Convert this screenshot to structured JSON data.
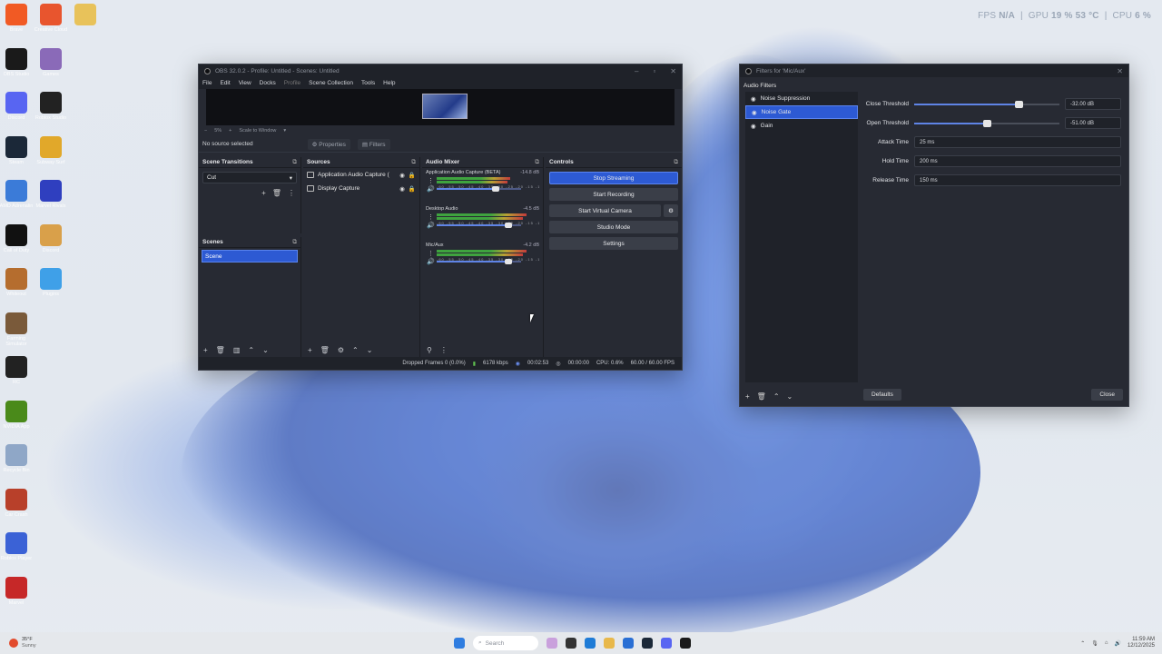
{
  "hud": {
    "fps_label": "FPS",
    "fps_value": "N/A",
    "gpu_label": "GPU",
    "gpu_value": "19 % 53 °C",
    "cpu_label": "CPU",
    "cpu_value": "6 %"
  },
  "desktop_icons": [
    {
      "label": "Brave",
      "color": "#f15a24"
    },
    {
      "label": "OBS Studio",
      "color": "#1a1a1a"
    },
    {
      "label": "Discord",
      "color": "#5865f2"
    },
    {
      "label": "Steam",
      "color": "#1b2838"
    },
    {
      "label": "AMD Adrenalin",
      "color": "#3b7bd8"
    },
    {
      "label": "Call of Duty",
      "color": "#111"
    },
    {
      "label": "Whiteout",
      "color": "#b56d2e"
    },
    {
      "label": "Farming Simulator",
      "color": "#7a5a3a"
    },
    {
      "label": "RC",
      "color": "#222"
    },
    {
      "label": "NVIDIA App",
      "color": "#4a8a1a"
    },
    {
      "label": "Recycle Bin",
      "color": "#8fa7c7"
    },
    {
      "label": "Car Crash",
      "color": "#b8402a"
    },
    {
      "label": "Roblox Player",
      "color": "#3b62d6"
    },
    {
      "label": "Marvel",
      "color": "#c62828"
    }
  ],
  "desktop_icons_col2": [
    {
      "label": "Creative Cloud",
      "color": "#e8552e"
    },
    {
      "label": "Games",
      "color": "#8a6ab8"
    },
    {
      "label": "Roblox Studio",
      "color": "#222"
    },
    {
      "label": "Subway Surf",
      "color": "#e1a82a"
    },
    {
      "label": "Marvel Rivals",
      "color": "#2f3fbf"
    },
    {
      "label": "Discord",
      "color": "#d9a04a"
    },
    {
      "label": "Plugins",
      "color": "#3fa0e8"
    }
  ],
  "obs": {
    "title": "OBS 32.0.2 - Profile: Untitled - Scenes: Untitled",
    "menu": [
      "File",
      "Edit",
      "View",
      "Docks",
      "Profile",
      "Scene Collection",
      "Tools",
      "Help"
    ],
    "zoom": "5%",
    "scale_mode": "Scale to Window",
    "no_source": "No source selected",
    "properties_btn": "Properties",
    "filters_btn": "Filters",
    "scene_transitions": {
      "title": "Scene Transitions",
      "value": "Cut"
    },
    "scenes": {
      "title": "Scenes",
      "items": [
        "Scene"
      ]
    },
    "sources": {
      "title": "Sources",
      "items": [
        "Application Audio Capture (",
        "Display Capture"
      ]
    },
    "mixer": {
      "title": "Audio Mixer",
      "ticks": "-60 -55 -50 -45 -40 -35 -30 -25 -20 -15 -10 -5 0",
      "channels": [
        {
          "name": "Application Audio Capture (BETA)",
          "db": "-14.8 dB",
          "level": 0.72
        },
        {
          "name": "Desktop Audio",
          "db": "-4.5 dB",
          "level": 0.88
        },
        {
          "name": "Mic/Aux",
          "db": "-4.2 dB",
          "level": 0.88
        }
      ]
    },
    "controls": {
      "title": "Controls",
      "stop_streaming": "Stop Streaming",
      "start_recording": "Start Recording",
      "start_virtual_camera": "Start Virtual Camera",
      "studio_mode": "Studio Mode",
      "settings": "Settings"
    },
    "status": {
      "dropped": "Dropped Frames 0 (0.0%)",
      "kbps": "6178 kbps",
      "stream_time": "00:02:53",
      "rec_time": "00:00:00",
      "cpu": "CPU: 0.6%",
      "fps": "60.00 / 60.00 FPS"
    }
  },
  "filters": {
    "title": "Filters for 'Mic/Aux'",
    "section": "Audio Filters",
    "items": [
      "Noise Suppression",
      "Noise Gate",
      "Gain"
    ],
    "selected": "Noise Gate",
    "props": [
      {
        "label": "Close Threshold",
        "value": "-32.00 dB",
        "level": 0.72
      },
      {
        "label": "Open Threshold",
        "value": "-51.00 dB",
        "level": 0.5
      }
    ],
    "times": [
      {
        "label": "Attack Time",
        "value": "25 ms"
      },
      {
        "label": "Hold Time",
        "value": "200 ms"
      },
      {
        "label": "Release Time",
        "value": "150 ms"
      }
    ],
    "defaults_btn": "Defaults",
    "close_btn": "Close"
  },
  "taskbar": {
    "weather_temp": "35°F",
    "weather_desc": "Sunny",
    "search_placeholder": "Search",
    "time": "11:59 AM",
    "date": "12/12/2025"
  }
}
